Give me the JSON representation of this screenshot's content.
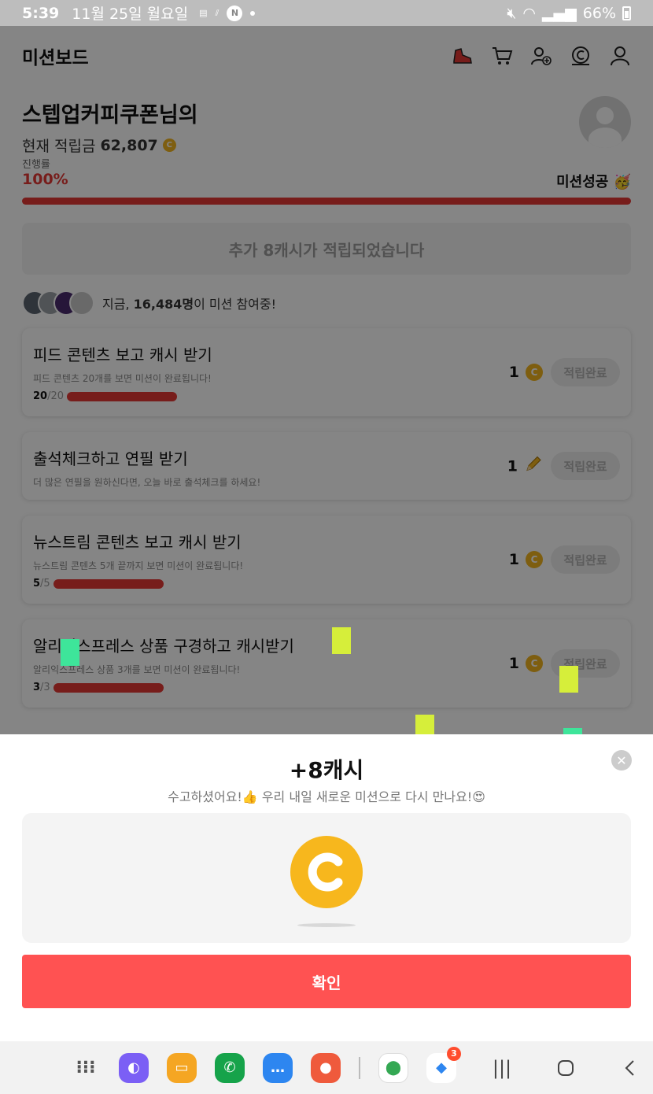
{
  "status_bar": {
    "time": "5:39",
    "date": "11월 25일 월요일",
    "battery": "66%"
  },
  "header": {
    "title": "미션보드",
    "icons": [
      "shoe-icon",
      "cart-icon",
      "add-user-icon",
      "coin-history-icon",
      "profile-icon"
    ]
  },
  "profile": {
    "name": "스텝업커피쿠폰님의",
    "balance_label": "현재 적립금",
    "balance_value": "62,807",
    "progress_label": "진행률",
    "progress_value": "100%",
    "progress_fraction": 1.0,
    "success_label": "미션성공 🥳"
  },
  "banner": {
    "text": "추가 8캐시가 적립되었습니다"
  },
  "participants": {
    "prefix": "지금,",
    "count": "16,484명",
    "suffix": "이 미션 참여중!"
  },
  "missions": [
    {
      "title": "피드 콘텐츠 보고 캐시 받기",
      "desc": "피드 콘텐츠 20개를 보면 미션이 완료됩니다!",
      "done": "20",
      "total": "/20",
      "reward": "1",
      "reward_icon": "coin-icon",
      "button": "적립완료"
    },
    {
      "title": "출석체크하고 연필 받기",
      "desc": "더 많은 연필을 원하신다면, 오늘 바로 출석체크를 하세요!",
      "done": "",
      "total": "",
      "reward": "1",
      "reward_icon": "pencil-icon",
      "button": "적립완료"
    },
    {
      "title": "뉴스트림 콘텐츠 보고 캐시 받기",
      "desc": "뉴스트림 콘텐츠 5개 끝까지 보면 미션이 완료됩니다!",
      "done": "5",
      "total": "/5",
      "reward": "1",
      "reward_icon": "coin-icon",
      "button": "적립완료"
    },
    {
      "title": "알리익스프레스 상품 구경하고 캐시받기",
      "desc": "알리익스프레스 상품 3개를 보면 미션이 완료됩니다!",
      "done": "3",
      "total": "/3",
      "reward": "1",
      "reward_icon": "coin-icon",
      "button": "적립완료"
    }
  ],
  "sheet": {
    "title": "+8캐시",
    "subtitle": "수고하셨어요!👍 우리 내일 새로운 미션으로 다시 만나요!😍",
    "confirm": "확인"
  },
  "navbar": {
    "apps": [
      "apps-grid-icon",
      "internet-icon",
      "files-icon",
      "phone-icon",
      "messages-icon",
      "contacts-icon",
      "maps-icon",
      "chat-icon"
    ],
    "chat_badge": "3"
  },
  "colors": {
    "accent": "#e53935",
    "confirm": "#ff5252",
    "coin": "#f2b41f"
  }
}
